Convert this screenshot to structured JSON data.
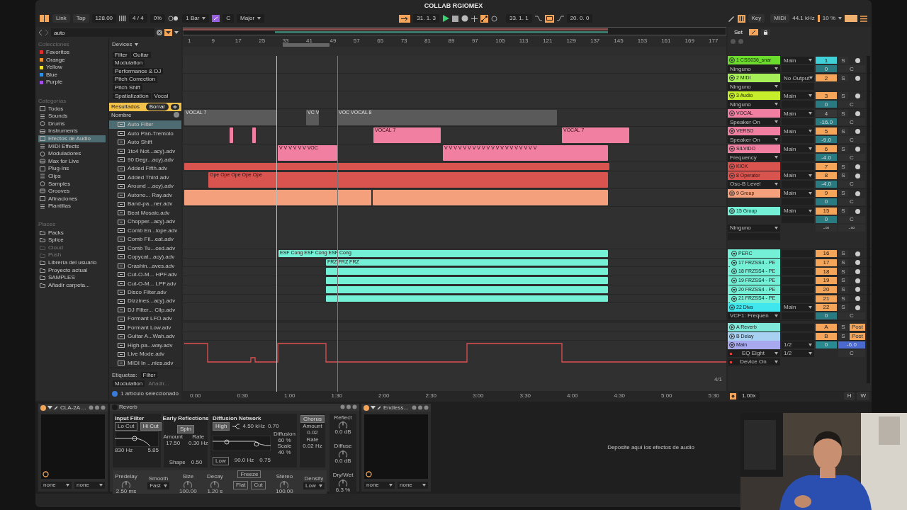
{
  "window": {
    "title": "COLLAB RGIOMEX"
  },
  "transport": {
    "left": [
      {
        "kind": "button",
        "label": "Link"
      },
      {
        "kind": "button",
        "label": "Tap"
      },
      {
        "kind": "field",
        "label": "128.00"
      },
      {
        "kind": "field",
        "label": "4 / 4"
      },
      {
        "kind": "field",
        "label": "0%"
      },
      {
        "kind": "select",
        "label": "1 Bar"
      },
      {
        "kind": "key",
        "label": "C"
      },
      {
        "kind": "select",
        "label": "Major"
      }
    ],
    "center": {
      "position": "31. 1. 3",
      "playing": true,
      "loop_start": "33. 1. 1",
      "loop_on": true,
      "loop_length": "20. 0. 0"
    },
    "right": {
      "key": "Key",
      "midi": "MIDI",
      "sample_rate": "44.1 kHz",
      "cpu": "10 %"
    }
  },
  "browser": {
    "search": {
      "value": "auto"
    },
    "collections": {
      "title": "Colecciones",
      "items": [
        {
          "label": "Favoritos",
          "color": "#e0302c"
        },
        {
          "label": "Orange",
          "color": "#f0922c"
        },
        {
          "label": "Yellow",
          "color": "#f0e02c"
        },
        {
          "label": "Blue",
          "color": "#3090e8"
        },
        {
          "label": "Purple",
          "color": "#a050e8"
        }
      ]
    },
    "categories": {
      "title": "Categorías",
      "items": [
        {
          "label": "Todos",
          "selected": false
        },
        {
          "label": "Sounds",
          "selected": false
        },
        {
          "label": "Drums",
          "selected": false
        },
        {
          "label": "Instruments",
          "selected": false
        },
        {
          "label": "Efectos de Audio",
          "selected": true
        },
        {
          "label": "MIDI Effects",
          "selected": false
        },
        {
          "label": "Moduladores",
          "selected": false
        },
        {
          "label": "Max for Live",
          "selected": false
        },
        {
          "label": "Plug-Ins",
          "selected": false
        },
        {
          "label": "Clips",
          "selected": false
        },
        {
          "label": "Samples",
          "selected": false
        },
        {
          "label": "Grooves",
          "selected": false
        },
        {
          "label": "Afinaciones",
          "selected": false
        },
        {
          "label": "Plantillas",
          "selected": false
        }
      ]
    },
    "places": {
      "title": "Places",
      "items": [
        {
          "label": "Packs",
          "disabled": false
        },
        {
          "label": "Splice",
          "disabled": false
        },
        {
          "label": "Cloud",
          "disabled": true
        },
        {
          "label": "Push",
          "disabled": true
        },
        {
          "label": "Librería del usuario",
          "disabled": false
        },
        {
          "label": "Proyecto actual",
          "disabled": false
        },
        {
          "label": "SAMPLES",
          "disabled": false
        },
        {
          "label": "Añadir carpeta...",
          "disabled": false
        }
      ]
    },
    "filter": {
      "title": "Devices",
      "tags": [
        "Filter",
        "Guitar",
        "Modulation",
        "Performance & DJ",
        "Pitch Correction",
        "Pitch Shift",
        "Spatialization",
        "Vocal"
      ]
    },
    "results": {
      "title": "Resultados",
      "clear": "Borrar",
      "column": "Nombre",
      "items": [
        {
          "label": "Auto Filter",
          "selected": true
        },
        {
          "label": "Auto Pan-Tremolo",
          "selected": false
        },
        {
          "label": "Auto Shift",
          "selected": false
        },
        {
          "label": "1to4 Not...acy).adv",
          "selected": false
        },
        {
          "label": "90 Degr...acy).adv",
          "selected": false
        },
        {
          "label": "Added Fifth.adv",
          "selected": false
        },
        {
          "label": "Added Third.adv",
          "selected": false
        },
        {
          "label": "Around ...acy).adv",
          "selected": false
        },
        {
          "label": "Autono... Ray.adv",
          "selected": false
        },
        {
          "label": "Band-pa...ner.adv",
          "selected": false
        },
        {
          "label": "Beat Mosaic.adv",
          "selected": false
        },
        {
          "label": "Chopper...acy).adv",
          "selected": false
        },
        {
          "label": "Comb En...lope.adv",
          "selected": false
        },
        {
          "label": "Comb Fil...eat.adv",
          "selected": false
        },
        {
          "label": "Comb Tu...ced.adv",
          "selected": false
        },
        {
          "label": "Copycat...acy).adv",
          "selected": false
        },
        {
          "label": "Crashin...aves.adv",
          "selected": false
        },
        {
          "label": "Cut-O-M... HPF.adv",
          "selected": false
        },
        {
          "label": "Cut-O-M... LPF.adv",
          "selected": false
        },
        {
          "label": "Disco Filter.adv",
          "selected": false
        },
        {
          "label": "Dizzines...acy).adv",
          "selected": false
        },
        {
          "label": "DJ Filter... Clip.adv",
          "selected": false
        },
        {
          "label": "Formant LFO.adv",
          "selected": false
        },
        {
          "label": "Formant Low.adv",
          "selected": false
        },
        {
          "label": "Guitar A...Wah.adv",
          "selected": false
        },
        {
          "label": "High-pa...way.adv",
          "selected": false
        },
        {
          "label": "Live Mode.adv",
          "selected": false
        },
        {
          "label": "MIDI In ...nies.adv",
          "selected": false
        }
      ]
    },
    "tags": {
      "title": "Etiquetas:",
      "items": [
        "Filter",
        "Modulation"
      ],
      "placeholder": "Añadir..."
    },
    "status": "1 artículo seleccionado"
  },
  "arrangement": {
    "bars": [
      "1",
      "9",
      "17",
      "25",
      "33",
      "41",
      "49",
      "57",
      "65",
      "73",
      "81",
      "89",
      "97",
      "105",
      "113",
      "121",
      "129",
      "137",
      "145",
      "153",
      "161",
      "169",
      "177"
    ],
    "times": [
      "0:00",
      "0:30",
      "1:00",
      "1:30",
      "2:00",
      "2:30",
      "3:00",
      "3:30",
      "4:00",
      "4:30",
      "5:00",
      "5:30"
    ],
    "meter": "4/1"
  },
  "mixer": {
    "set": "Set",
    "zoom": "1.00x",
    "h": "H",
    "w": "W"
  },
  "tracks": [
    {
      "name": "1 CSS036_snar",
      "color": "#6bdc2c",
      "kind": "track",
      "selected": true,
      "active": true,
      "output": "Main",
      "sub": "Ninguno",
      "number": "1",
      "volume": "0",
      "solo": "S",
      "pan": "C"
    },
    {
      "name": "2 MIDI",
      "color": "#a6ef58",
      "kind": "track",
      "selected": false,
      "active": true,
      "output": "No Output",
      "sub": "Ninguno",
      "number": "2",
      "solo": "S"
    },
    {
      "name": "3 Audio",
      "color": "#c6ee2a",
      "kind": "track",
      "selected": false,
      "active": true,
      "output": "Main",
      "sub": "Ninguno",
      "number": "3",
      "volume": "0",
      "solo": "S",
      "pan": "C"
    },
    {
      "name": "VOCAL",
      "color": "#f07fa2",
      "kind": "track",
      "selected": false,
      "active": false,
      "output": "Main",
      "sub": "Speaker On",
      "number": "4",
      "volume": "-16.0",
      "solo": "S",
      "pan": "C",
      "clips": [
        {
          "label": "VOCAL 7",
          "active": false
        },
        {
          "label": "VC V",
          "active": false
        },
        {
          "label": "VOC VOCAL 8",
          "active": false
        }
      ]
    },
    {
      "name": "VERSO",
      "color": "#f07fa2",
      "kind": "track",
      "selected": false,
      "active": true,
      "output": "Main",
      "sub": "Speaker On",
      "number": "5",
      "volume": "-9.0",
      "solo": "S",
      "pan": "C",
      "clips": [
        {
          "label": "VOCAL 7",
          "active": true
        },
        {
          "label": "VOCAL 7",
          "active": true
        }
      ]
    },
    {
      "name": "SILVIDO",
      "color": "#f07fa2",
      "kind": "track",
      "selected": false,
      "active": true,
      "output": "Main",
      "sub": "Frequency",
      "number": "6",
      "volume": "-4.0",
      "solo": "S",
      "pan": "C",
      "clips": [
        {
          "label": "V V V V V V VOC",
          "active": true
        },
        {
          "label": "V V V V V V V V V V V V V V V V V V V V",
          "active": true
        }
      ]
    },
    {
      "name": "KICK",
      "color": "#d9534f",
      "kind": "track",
      "selected": false,
      "active": true,
      "number": "7",
      "solo": "S"
    },
    {
      "name": "8 Operator",
      "color": "#d9534f",
      "kind": "track",
      "selected": false,
      "active": true,
      "output": "Main",
      "sub": "Osc-B Level",
      "number": "8",
      "volume": "-4.0",
      "solo": "S",
      "pan": "C",
      "clips": [
        {
          "label": "Ope Ope Ope Ope Ope",
          "active": true
        }
      ]
    },
    {
      "name": "9 Group",
      "color": "#f4a07c",
      "kind": "group",
      "expanded": false,
      "selected": false,
      "active": true,
      "output": "Main",
      "number": "9",
      "volume": "0",
      "solo": "S",
      "pan": "C"
    },
    {
      "name": "15 Group",
      "color": "#74f0d6",
      "kind": "group",
      "expanded": true,
      "selected": false,
      "active": true,
      "output": "Main",
      "sub": "Ninguno",
      "number": "15",
      "volume": "0",
      "solo": "S",
      "pan": "C",
      "peaks": [
        "-∞",
        "-∞"
      ],
      "children": [
        {
          "name": "PERC",
          "color": "#74f0d6",
          "kind": "track",
          "selected": false,
          "active": true,
          "number": "16",
          "solo": "S",
          "clips": [
            {
              "label": "ESF Cong ESF Cong ESF Cong",
              "active": true
            }
          ]
        },
        {
          "name": "17 FRZSS4 - PE",
          "color": "#74f0d6",
          "kind": "track",
          "selected": false,
          "active": true,
          "number": "17",
          "solo": "S",
          "clips": [
            {
              "label": "FRZ FRZ FRZ",
              "active": true
            }
          ]
        },
        {
          "name": "18 FRZSS4 - PE",
          "color": "#74f0d6",
          "kind": "track",
          "selected": false,
          "active": true,
          "number": "18",
          "solo": "S"
        },
        {
          "name": "19 FRZSS4 - PE",
          "color": "#74f0d6",
          "kind": "track",
          "selected": false,
          "active": true,
          "number": "19",
          "solo": "S"
        },
        {
          "name": "20 FRZSS4 - PE",
          "color": "#74f0d6",
          "kind": "track",
          "selected": false,
          "active": true,
          "number": "20",
          "solo": "S"
        },
        {
          "name": "21 FRZSS4 - PE",
          "color": "#74f0d6",
          "kind": "track",
          "selected": false,
          "active": true,
          "number": "21",
          "solo": "S"
        }
      ]
    },
    {
      "name": "22 Diva",
      "color": "#3fe6ee",
      "kind": "track",
      "selected": false,
      "active": true,
      "output": "Main",
      "sub": "VCF1: Frequen",
      "number": "22",
      "volume": "0",
      "solo": "S",
      "pan": "C"
    }
  ],
  "returns": [
    {
      "name": "A Reverb",
      "color": "#7fe8d8",
      "number": "A",
      "solo": "S",
      "post": "Post"
    },
    {
      "name": "B Delay",
      "color": "#a8d0f0",
      "number": "B",
      "solo": "S",
      "post": "Post"
    }
  ],
  "main": {
    "name": "Main",
    "color": "#a8a8ee",
    "output": "1/2",
    "cue": "0",
    "volume": "-6.0",
    "pan": "C",
    "devices": [
      {
        "name": "EQ Eight",
        "output": "1/2"
      },
      {
        "name": "Device On"
      }
    ]
  },
  "devices": [
    {
      "kind": "plugin",
      "title": "CLA-2A ...",
      "on": true,
      "selectors": [
        "none",
        "none"
      ]
    },
    {
      "kind": "reverb",
      "title": "Reverb",
      "on": false,
      "input_filter": {
        "title": "Input Filter",
        "buttons": [
          {
            "label": "Lo Cut",
            "on": false
          },
          {
            "label": "Hi Cut",
            "on": true
          }
        ],
        "freq": "830 Hz",
        "q": "5.85"
      },
      "early": {
        "title": "Early Reflections",
        "spin": "Spin",
        "params": [
          {
            "label": "Amount",
            "value": "17.50"
          },
          {
            "label": "Rate",
            "value": "0.30 Hz"
          }
        ],
        "shape_label": "Shape",
        "shape": "0.50"
      },
      "diffusion": {
        "title": "Diffusion Network",
        "high": "High",
        "high_freq": "4.50 kHz",
        "high_val": "0.70",
        "params": [
          {
            "label": "Diffusion",
            "value": "60 %"
          },
          {
            "label": "Scale",
            "value": "40 %"
          }
        ],
        "low": "Low",
        "low_freq": "90.0 Hz",
        "low_val": "0.75"
      },
      "chorus": {
        "title": "Chorus",
        "params": [
          {
            "label": "Amount",
            "value": "0.02"
          },
          {
            "label": "Rate",
            "value": "0.02 Hz"
          }
        ]
      },
      "outputs": [
        {
          "label": "Reflect",
          "value": "0.0 dB"
        },
        {
          "label": "Diffuse",
          "value": "0.0 dB"
        },
        {
          "label": "Dry/Wet",
          "value": "6.3 %"
        }
      ],
      "bottom": [
        {
          "kind": "knob",
          "label": "Predelay",
          "value": "2.50 ms"
        },
        {
          "kind": "select",
          "label": "Smooth",
          "value": "Fast"
        },
        {
          "kind": "knob",
          "label": "Size",
          "value": "100.00"
        },
        {
          "kind": "knob",
          "label": "Decay",
          "value": "1.20 s"
        },
        {
          "kind": "freeze",
          "label": "Freeze",
          "buttons": [
            "Flat",
            "Cut"
          ]
        },
        {
          "kind": "knob",
          "label": "Stereo",
          "value": "100.00"
        },
        {
          "kind": "select",
          "label": "Density",
          "value": "Low"
        }
      ]
    },
    {
      "kind": "plugin",
      "title": "Endless...",
      "on": true,
      "selectors": [
        "none",
        "none"
      ]
    }
  ],
  "drop_hint": "Deposite aquí los efectos de audio"
}
